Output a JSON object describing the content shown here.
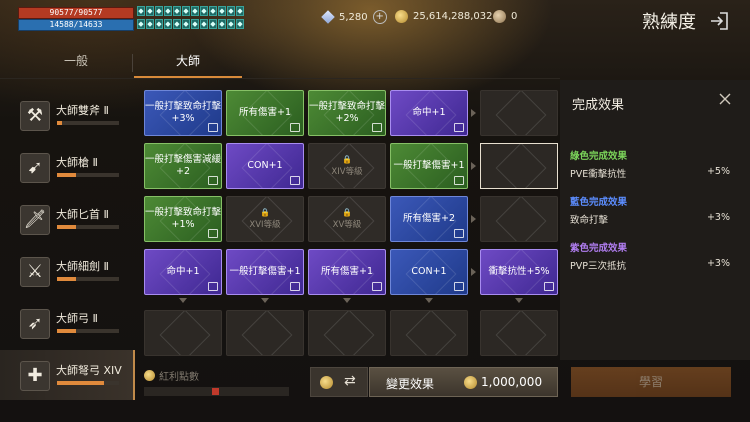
{
  "player": {
    "hp": "90577/90577",
    "mp": "14588/14633"
  },
  "buffs": [
    "◆",
    "◆",
    "◆",
    "◆",
    "◆",
    "◆",
    "◆",
    "◆",
    "◆",
    "◆",
    "◆",
    "◆",
    "◆",
    "◆",
    "◆",
    "◆",
    "◆",
    "◆",
    "◆",
    "◆",
    "◆",
    "◆",
    "◆",
    "◆"
  ],
  "currency": {
    "diamonds": "5,280",
    "gold": "25,614,288,032",
    "points": "0"
  },
  "header": {
    "title": "熟練度"
  },
  "tabs": [
    {
      "label": "一般"
    },
    {
      "label": "大師"
    }
  ],
  "weapons": [
    {
      "name": "大師雙斧 Ⅱ",
      "icon": "axe-icon",
      "glyph": "⚒",
      "progress": 0.08
    },
    {
      "name": "大師槍 Ⅱ",
      "icon": "spear-icon",
      "glyph": "➹",
      "progress": 0.3
    },
    {
      "name": "大師匕首 Ⅱ",
      "icon": "dagger-icon",
      "glyph": "🗡",
      "progress": 0.3
    },
    {
      "name": "大師細劍 Ⅱ",
      "icon": "rapier-icon",
      "glyph": "⚔",
      "progress": 0.3
    },
    {
      "name": "大師弓 Ⅱ",
      "icon": "bow-icon",
      "glyph": "➶",
      "progress": 0.3
    },
    {
      "name": "大師弩弓 XIV",
      "icon": "crossbow-icon",
      "glyph": "✚",
      "progress": 0.75
    }
  ],
  "grid": [
    [
      {
        "type": "blue",
        "text": "一般打擊致命打擊\n+3%"
      },
      {
        "type": "green",
        "text": "所有傷害+1"
      },
      {
        "type": "green",
        "text": "一般打擊致命打擊\n+2%"
      },
      {
        "type": "purple",
        "text": "命中+1"
      },
      {
        "type": "empty",
        "text": ""
      }
    ],
    [
      {
        "type": "green",
        "text": "一般打擊傷害減緩\n+2"
      },
      {
        "type": "purple",
        "text": "CON+1"
      },
      {
        "type": "locked",
        "text": "XIV等級"
      },
      {
        "type": "green",
        "text": "一般打擊傷害+1"
      },
      {
        "type": "empty",
        "text": ""
      }
    ],
    [
      {
        "type": "green",
        "text": "一般打擊致命打擊\n+1%"
      },
      {
        "type": "locked",
        "text": "XVI等級"
      },
      {
        "type": "locked",
        "text": "XV等級"
      },
      {
        "type": "blue",
        "text": "所有傷害+2"
      },
      {
        "type": "empty",
        "text": ""
      }
    ],
    [
      {
        "type": "purple",
        "text": "命中+1"
      },
      {
        "type": "purple",
        "text": "一般打擊傷害+1"
      },
      {
        "type": "purple",
        "text": "所有傷害+1"
      },
      {
        "type": "blue",
        "text": "CON+1"
      },
      {
        "type": "purple",
        "text": "衝擊抗性+5%"
      }
    ],
    [
      {
        "type": "empty",
        "text": ""
      },
      {
        "type": "empty",
        "text": ""
      },
      {
        "type": "empty",
        "text": ""
      },
      {
        "type": "empty",
        "text": ""
      },
      {
        "type": "empty",
        "text": ""
      }
    ]
  ],
  "panel": {
    "title": "完成效果",
    "sections": [
      {
        "header": "綠色完成效果",
        "color": "#7bd35a",
        "stat": "PVE衝擊抗性",
        "value": "+5%"
      },
      {
        "header": "藍色完成效果",
        "color": "#5c8dff",
        "stat": "致命打擊",
        "value": "+3%"
      },
      {
        "header": "紫色完成效果",
        "color": "#b07df0",
        "stat": "PVP三次抵抗",
        "value": "+3%"
      }
    ]
  },
  "bottom": {
    "bonus_label": "紅利點數",
    "change_label": "變更效果",
    "change_cost": "1,000,000",
    "learn_label": "學習"
  },
  "colors": {
    "accent": "#e08a3c"
  }
}
